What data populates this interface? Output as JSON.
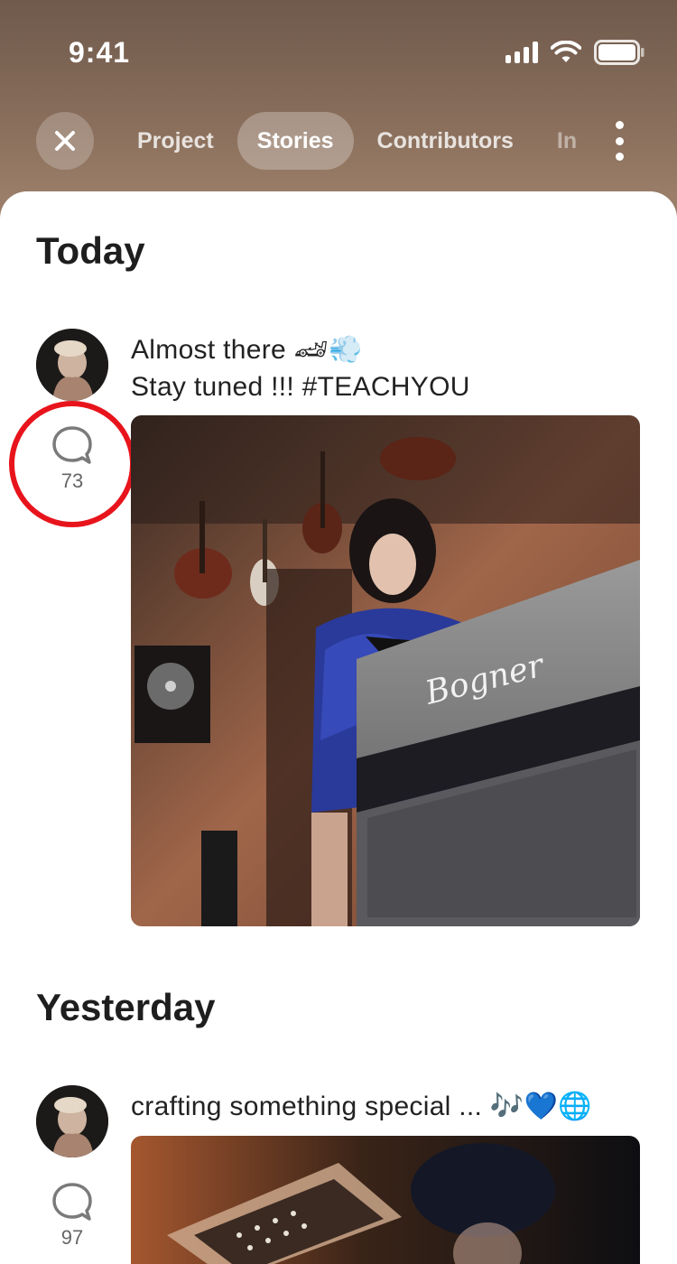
{
  "status_bar": {
    "time": "9:41"
  },
  "header": {
    "close_icon": "close-icon",
    "tabs": [
      {
        "label": "Project",
        "active": false
      },
      {
        "label": "Stories",
        "active": true
      },
      {
        "label": "Contributors",
        "active": false
      },
      {
        "label": "In",
        "active": false
      }
    ],
    "more_icon": "more-vertical-icon"
  },
  "sections": [
    {
      "title": "Today",
      "post": {
        "caption_line1": "Almost there 🏎💨",
        "caption_line2": "Stay tuned !!! #TEACHYOU",
        "comments": "73",
        "photo_amp_logo": "Bogner"
      }
    },
    {
      "title": "Yesterday",
      "post": {
        "caption_line1": "crafting something special ... 🎶💙🌐",
        "comments": "97"
      }
    }
  ],
  "colors": {
    "highlight": "#e8141c",
    "background": "#8a6f5c"
  }
}
